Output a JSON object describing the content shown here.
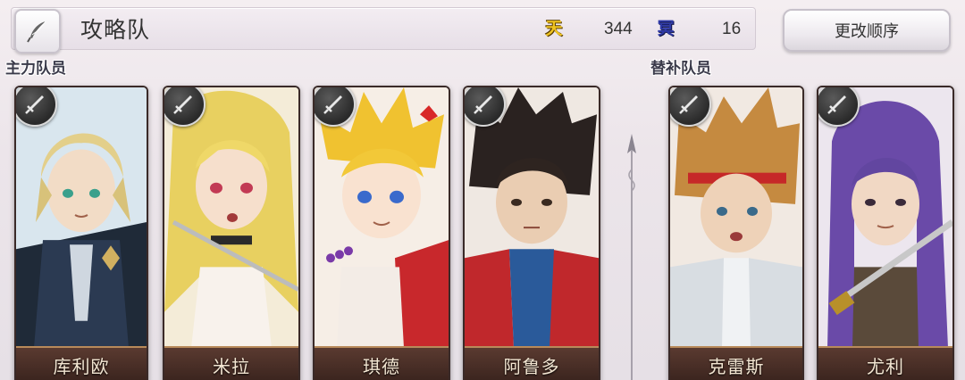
{
  "header": {
    "team_name": "攻略队",
    "heaven": {
      "glyph": "天",
      "value": "344",
      "color": "#f0c420"
    },
    "hell": {
      "glyph": "冥",
      "value": "16",
      "color": "#2f3aa8"
    },
    "reorder_label": "更改顺序",
    "edit_icon": "quill-icon"
  },
  "sections": {
    "main_label": "主力队员",
    "reserve_label": "替补队员"
  },
  "members": [
    {
      "name": "库利欧",
      "weapon_icon": "sword-icon",
      "group": "main"
    },
    {
      "name": "米拉",
      "weapon_icon": "sword-icon",
      "group": "main"
    },
    {
      "name": "琪德",
      "weapon_icon": "sword-icon",
      "group": "main"
    },
    {
      "name": "阿鲁多",
      "weapon_icon": "sword-icon",
      "group": "main"
    },
    {
      "name": "克雷斯",
      "weapon_icon": "sword-icon",
      "group": "reserve"
    },
    {
      "name": "尤利",
      "weapon_icon": "sword-icon",
      "group": "reserve"
    }
  ]
}
